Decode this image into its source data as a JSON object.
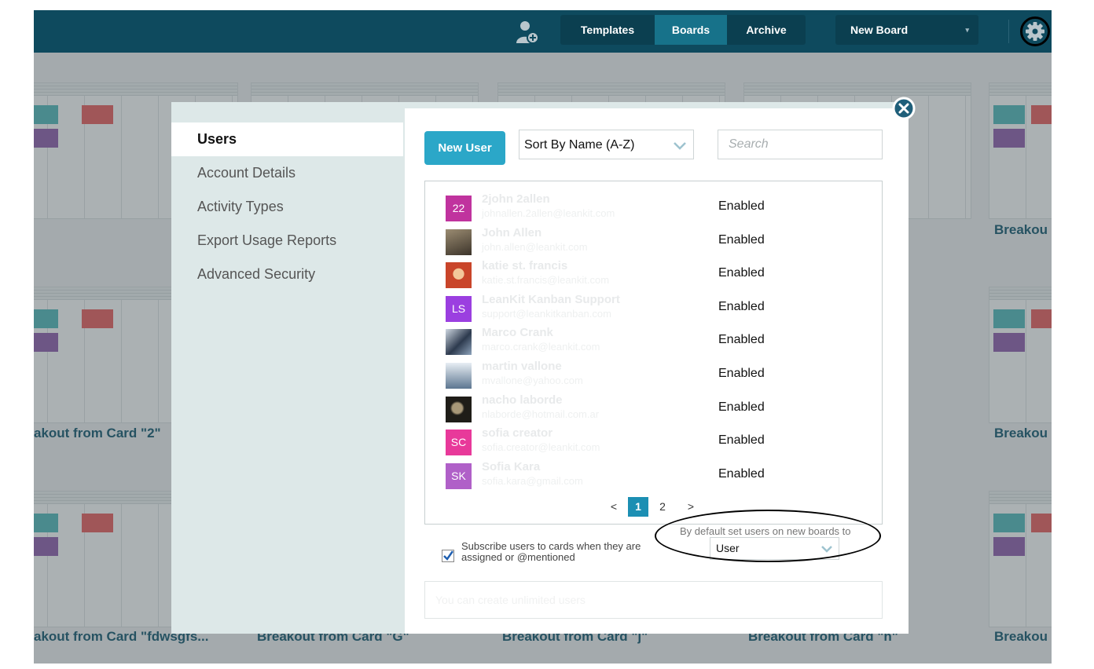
{
  "topbar": {
    "add_user_icon": "add-user-icon",
    "tabs": [
      {
        "label": "Templates",
        "active": false
      },
      {
        "label": "Boards",
        "active": true
      },
      {
        "label": "Archive",
        "active": false
      }
    ],
    "new_board": {
      "label": "New Board",
      "caret": "▾"
    },
    "settings_icon": "gear-icon"
  },
  "background_boards": {
    "labels": [
      "Breakou",
      "akout from Card \"2\"",
      "Breakou",
      "akout from Card \"fdwsgfs...",
      "Breakout from Card \"G\"",
      "Breakout from Card \"j\"",
      "Breakout from Card \"h\"",
      "Breakou"
    ],
    "swatch_colors": {
      "teal": "#4fb3b6",
      "red": "#e25b5b",
      "purple": "#8a5aa8"
    }
  },
  "modal": {
    "close_icon": "close-icon",
    "nav": [
      {
        "label": "Users",
        "active": true
      },
      {
        "label": "Account Details",
        "active": false
      },
      {
        "label": "Activity Types",
        "active": false
      },
      {
        "label": "Export Usage Reports",
        "active": false
      },
      {
        "label": "Advanced Security",
        "active": false
      }
    ],
    "new_user_label": "New User",
    "sort": {
      "selected": "Sort By Name (A-Z)"
    },
    "search": {
      "placeholder": "Search"
    },
    "users": [
      {
        "initials": "22",
        "avatar_color": "#c0339e",
        "name": "2john 2allen",
        "email": "johnallen.2allen@leankit.com",
        "status": "Enabled"
      },
      {
        "initials": "",
        "avatar_color": "#7a6a52",
        "name": "John Allen",
        "email": "john.allen@leankit.com",
        "status": "Enabled"
      },
      {
        "initials": "",
        "avatar_color": "#d36a3a",
        "name": "katie st. francis",
        "email": "katie.st.francis@leankit.com",
        "status": "Enabled"
      },
      {
        "initials": "LS",
        "avatar_color": "#9b3fe0",
        "name": "LeanKit Kanban Support",
        "email": "support@leankitkanban.com",
        "status": "Enabled"
      },
      {
        "initials": "",
        "avatar_color": "#4a5a6e",
        "name": "Marco Crank",
        "email": "marco.crank@leankit.com",
        "status": "Enabled"
      },
      {
        "initials": "",
        "avatar_color": "#8aa0b5",
        "name": "martin vallone",
        "email": "mvallone@yahoo.com",
        "status": "Enabled"
      },
      {
        "initials": "",
        "avatar_color": "#3c3a30",
        "name": "nacho laborde",
        "email": "nlaborde@hotmail.com.ar",
        "status": "Enabled"
      },
      {
        "initials": "SC",
        "avatar_color": "#e8399a",
        "name": "sofia creator",
        "email": "sofia.creator@leankit.com",
        "status": "Enabled"
      },
      {
        "initials": "SK",
        "avatar_color": "#b060c8",
        "name": "Sofia Kara",
        "email": "sofia.kara@gmail.com",
        "status": "Enabled"
      }
    ],
    "pagination": {
      "prev": "<",
      "pages": [
        "1",
        "2"
      ],
      "current": "1",
      "next": ">"
    },
    "subscribe": {
      "checked": true,
      "label": "Subscribe users to cards when they are assigned or @mentioned"
    },
    "default_role": {
      "label": "By default set users on new boards to",
      "selected": "User"
    },
    "notice": "You can create unlimited users"
  }
}
